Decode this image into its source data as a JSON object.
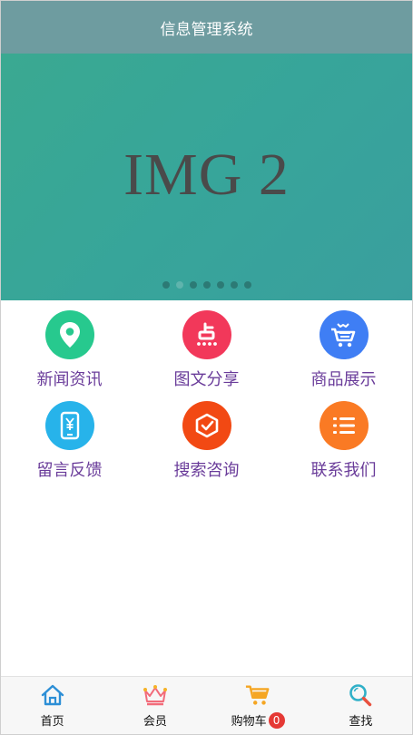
{
  "header": {
    "title": "信息管理系统"
  },
  "banner": {
    "text": "IMG 2",
    "dot_count": 7,
    "active_dot": 1
  },
  "grid": {
    "items": [
      {
        "label": "新闻资讯",
        "icon": "location-pin-icon",
        "color": "#27c98e"
      },
      {
        "label": "图文分享",
        "icon": "dianping-icon",
        "color": "#f2385a"
      },
      {
        "label": "商品展示",
        "icon": "shopping-cart-icon",
        "color": "#3f7ef4"
      },
      {
        "label": "留言反馈",
        "icon": "phone-yen-icon",
        "color": "#27b3ea"
      },
      {
        "label": "搜索咨询",
        "icon": "check-shield-icon",
        "color": "#f24913"
      },
      {
        "label": "联系我们",
        "icon": "list-icon",
        "color": "#fa7a24"
      }
    ]
  },
  "tabbar": {
    "items": [
      {
        "label": "首页",
        "icon": "home-icon"
      },
      {
        "label": "会员",
        "icon": "crown-icon"
      },
      {
        "label": "购物车",
        "icon": "cart-icon",
        "badge": "0"
      },
      {
        "label": "查找",
        "icon": "search-icon"
      }
    ]
  }
}
